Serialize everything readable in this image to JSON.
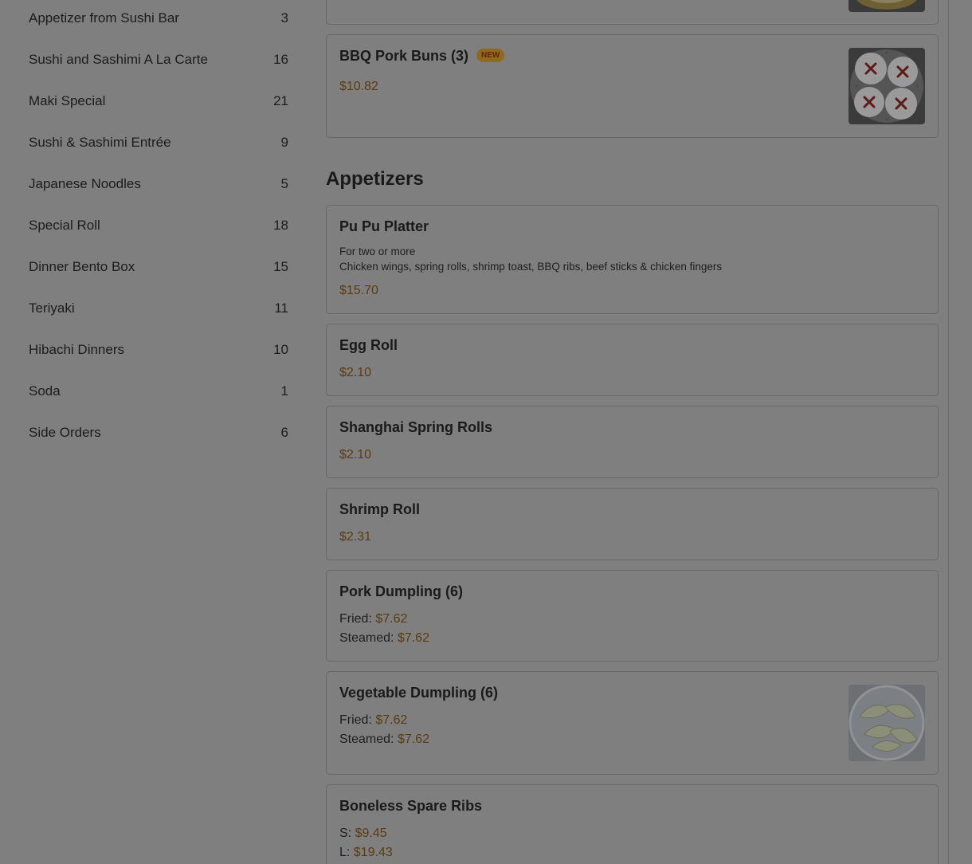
{
  "sidebar": {
    "categories": [
      {
        "label": "Appetizer from Sushi Bar",
        "count": "3"
      },
      {
        "label": "Sushi and Sashimi A La Carte",
        "count": "16"
      },
      {
        "label": "Maki Special",
        "count": "21"
      },
      {
        "label": "Sushi & Sashimi Entrée",
        "count": "9"
      },
      {
        "label": "Japanese Noodles",
        "count": "5"
      },
      {
        "label": "Special Roll",
        "count": "18"
      },
      {
        "label": "Dinner Bento Box",
        "count": "15"
      },
      {
        "label": "Teriyaki",
        "count": "11"
      },
      {
        "label": "Hibachi Dinners",
        "count": "10"
      },
      {
        "label": "Soda",
        "count": "1"
      },
      {
        "label": "Side Orders",
        "count": "6"
      }
    ]
  },
  "menu": {
    "bbq_item": {
      "name": "BBQ Pork Buns (3)",
      "badge": "NEW",
      "price": "$10.82"
    },
    "section_title": "Appetizers",
    "items": [
      {
        "name": "Pu Pu Platter",
        "desc1": "For two or more",
        "desc2": "Chicken wings, spring rolls, shrimp toast, BBQ ribs, beef sticks & chicken fingers",
        "price": "$15.70"
      },
      {
        "name": "Egg Roll",
        "price": "$2.10"
      },
      {
        "name": "Shanghai Spring Rolls",
        "price": "$2.10"
      },
      {
        "name": "Shrimp Roll",
        "price": "$2.31"
      },
      {
        "name": "Pork Dumpling (6)",
        "opt1_label": "Fried:",
        "opt1_price": "$7.62",
        "opt2_label": "Steamed:",
        "opt2_price": "$7.62"
      },
      {
        "name": "Vegetable Dumpling (6)",
        "opt1_label": "Fried:",
        "opt1_price": "$7.62",
        "opt2_label": "Steamed:",
        "opt2_price": "$7.62"
      },
      {
        "name": "Boneless Spare Ribs",
        "opt1_label": "S:",
        "opt1_price": "$9.45",
        "opt2_label": "L:",
        "opt2_price": "$19.43"
      }
    ]
  },
  "colors": {
    "overlay_bg": "#7f7f7f",
    "price": "#5a3c10",
    "badge_bg": "#8c6a1e",
    "badge_text": "#6b1f0f"
  },
  "icons": [
    "bbq-pork-buns-photo",
    "vegetable-dumpling-photo",
    "previous-item-photo"
  ]
}
